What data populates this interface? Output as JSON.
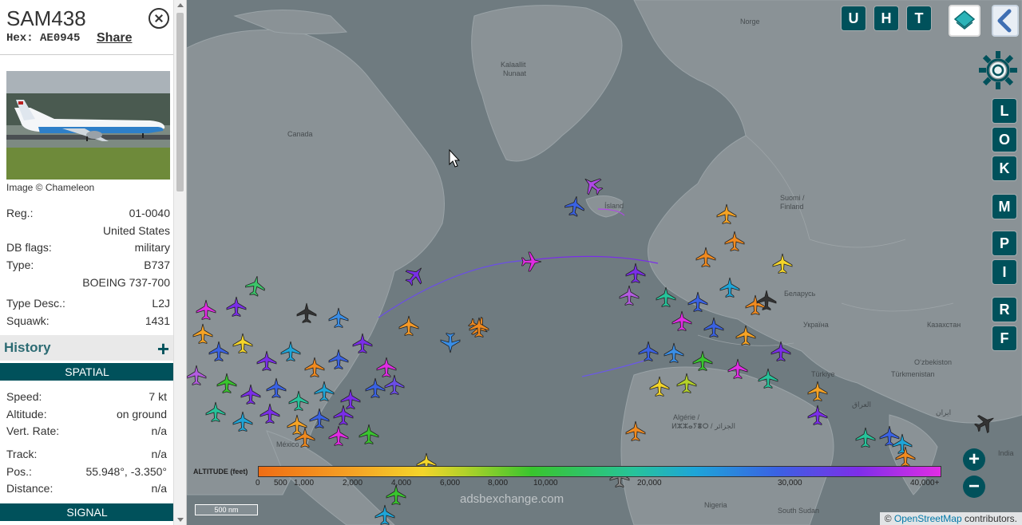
{
  "sidebar": {
    "callsign": "SAM438",
    "hex_label": "Hex:",
    "hex_value": "AE0945",
    "share_label": "Share",
    "image_credit": "Image © Chameleon",
    "details": [
      {
        "k": "Reg.:",
        "v": "01-0040"
      },
      {
        "k": "",
        "v": "United States"
      },
      {
        "k": "DB flags:",
        "v": "military"
      },
      {
        "k": "Type:",
        "v": "B737"
      },
      {
        "k": "",
        "v": "BOEING 737-700"
      },
      {
        "k": "Type Desc.:",
        "v": "L2J"
      },
      {
        "k": "Squawk:",
        "v": "1431"
      }
    ],
    "history_label": "History",
    "spatial_label": "SPATIAL",
    "spatial": [
      {
        "k": "Speed:",
        "v": "7 kt"
      },
      {
        "k": "Altitude:",
        "v": "on ground"
      },
      {
        "k": "Vert. Rate:",
        "v": "n/a"
      },
      {
        "k": "Track:",
        "v": "n/a"
      },
      {
        "k": "Pos.:",
        "v": "55.948°, -3.350°"
      },
      {
        "k": "Distance:",
        "v": "n/a"
      }
    ],
    "signal_label": "SIGNAL"
  },
  "map": {
    "place_labels": {
      "kalaallit": "Kalaallit",
      "nunaat": "Nunaat",
      "canada": "Canada",
      "island": "Ísland",
      "norge": "Norge",
      "suomi": "Suomi /",
      "finland": "Finland",
      "belarus": "Беларусь",
      "ukraina": "Україна",
      "kazakhstan": "Казахстан",
      "uzbekistan": "Oʻzbekiston",
      "turkmenistan": "Türkmenistan",
      "turkiye": "Türkiye",
      "iraq": "العراق",
      "india": "India",
      "algerie": "Algérie /",
      "algerie_ar": "ⵍⵣⵣⴰⵢⴻⵔ / الجزائر",
      "nigeria": "Nigeria",
      "south_sudan": "South Sudan",
      "mexico": "México",
      "iran": "ایران"
    },
    "top_buttons": [
      "U",
      "H",
      "T"
    ],
    "side_buttons": [
      "L",
      "O",
      "K",
      "M",
      "P",
      "I",
      "R",
      "F"
    ],
    "zoom_in": "+",
    "zoom_out": "−",
    "altitude_legend": {
      "label": "ALTITUDE (feet)",
      "ticks": [
        "0",
        "500",
        "1,000",
        "2,000",
        "4,000",
        "6,000",
        "8,000",
        "10,000",
        "20,000",
        "30,000",
        "40,000+"
      ]
    },
    "scale": "500 nm",
    "watermark": "adsbexchange.com",
    "attribution_prefix": "© ",
    "attribution_link": "OpenStreetMap",
    "attribution_suffix": " contributors."
  },
  "colors": {
    "accent": "#00515b",
    "map_water": "#6f7b80",
    "map_land": "#8a9296",
    "selected_track": "#7a2ee8"
  }
}
